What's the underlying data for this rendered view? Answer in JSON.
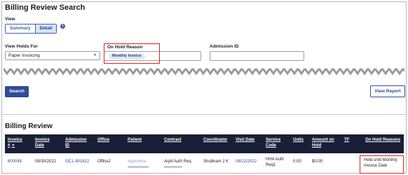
{
  "page": {
    "title": "Billing Review Search"
  },
  "view": {
    "label": "View",
    "options": [
      "Summary",
      "Detail"
    ],
    "selected": "Detail"
  },
  "filters": {
    "holds_for": {
      "label": "View Holds For",
      "value": "Paper Invoicing"
    },
    "on_hold_reason": {
      "label": "On Hold Reason",
      "chip": "Monthly Invoice"
    },
    "admission_id": {
      "label": "Admission ID",
      "value": ""
    }
  },
  "buttons": {
    "search": "Search",
    "view_report": "View Report"
  },
  "results": {
    "title": "Billing Review",
    "columns": [
      {
        "line1": "Invoice",
        "line2": "# ▼"
      },
      {
        "line1": "Invoice",
        "line2": "Date"
      },
      {
        "line1": "Admission",
        "line2": "ID"
      },
      {
        "line1": "Office",
        "line2": ""
      },
      {
        "line1": "Patient",
        "line2": ""
      },
      {
        "line1": "Contract",
        "line2": ""
      },
      {
        "line1": "Coordinator",
        "line2": ""
      },
      {
        "line1": "Visit Date",
        "line2": ""
      },
      {
        "line1": "Service",
        "line2": "Code"
      },
      {
        "line1": "Units",
        "line2": ""
      },
      {
        "line1": "Amount on",
        "line2": "Hold"
      },
      {
        "line1": "TF",
        "line2": ""
      },
      {
        "line1": "On Hold Reasons",
        "line2": ""
      }
    ],
    "rows": [
      {
        "invoice": "600048",
        "invoice_date": "08/30/2022",
        "admission_id": "OC1-901622",
        "office": "Office2",
        "patient": "Appcheck,",
        "contract": "Arpit Auth Req",
        "coordinator": "Shubham J K",
        "visit_date": "08/22/2022",
        "service_code_1": "HHA Auth",
        "service_code_2": "Req1",
        "units": "0.00",
        "amount_on_hold": "$0.00",
        "tf": "",
        "on_hold_reason_1": "Held until Monthly",
        "on_hold_reason_2": "Invoice Date"
      }
    ]
  },
  "colors": {
    "header_bg": "#1a1f38",
    "primary": "#2f4b9a",
    "highlight": "#e02020"
  }
}
